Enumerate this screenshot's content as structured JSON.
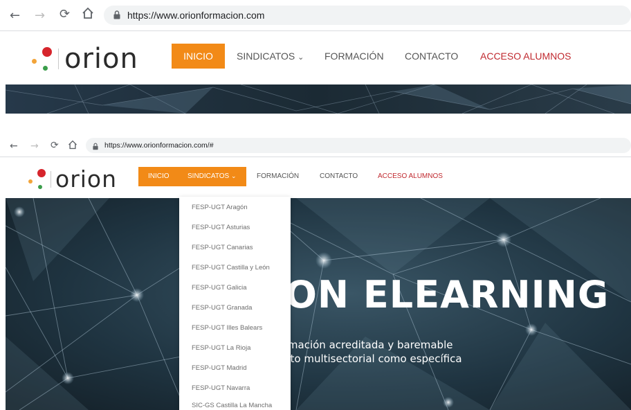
{
  "top": {
    "browser": {
      "url": "https://www.orionformacion.com"
    },
    "logo": {
      "text": "orion"
    },
    "menu": {
      "inicio": "INICIO",
      "sindicatos": "SINDICATOS",
      "sindicatos_chevron": "⌄",
      "formacion": "FORMACIÓN",
      "contacto": "CONTACTO",
      "acceso": "ACCESO ALUMNOS"
    }
  },
  "bottom": {
    "browser": {
      "url": "https://www.orionformacion.com/#"
    },
    "logo": {
      "text": "orion"
    },
    "menu": {
      "inicio": "INICIO",
      "sindicatos": "SINDICATOS",
      "sindicatos_chevron": "⌄",
      "formacion": "FORMACIÓN",
      "contacto": "CONTACTO",
      "acceso": "ACCESO ALUMNOS"
    },
    "dropdown": [
      "FESP-UGT Aragón",
      "FESP-UGT Asturias",
      "FESP-UGT Canarias",
      "FESP-UGT Castilla y León",
      "FESP-UGT Galicia",
      "FESP-UGT Granada",
      "FESP-UGT Illes Balears",
      "FESP-UGT La Rioja",
      "FESP-UGT Madrid",
      "FESP-UGT Navarra",
      "SIC-GS Castilla La Mancha"
    ],
    "hero": {
      "title": "ON ELEARNING",
      "line1": "rmación acreditada y baremable",
      "line2": "nto multisectorial como específica"
    }
  },
  "colors": {
    "accent_orange": "#f28a17",
    "accent_red": "#c0292f",
    "logo_dot_red": "#d6252c",
    "logo_dot_orange": "#f2a43a",
    "logo_dot_green": "#3a9d4a",
    "hero_bg": "#1e2d37"
  }
}
